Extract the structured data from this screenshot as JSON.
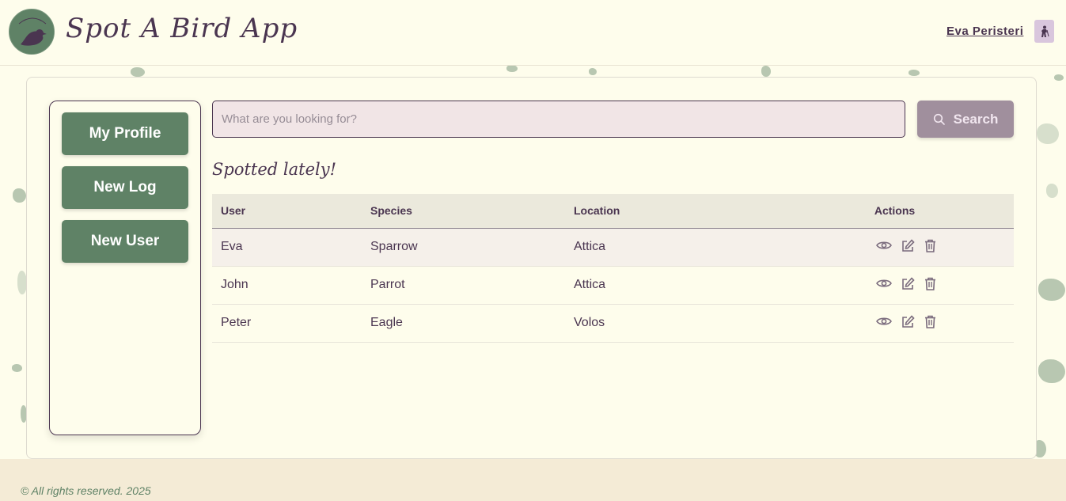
{
  "header": {
    "app_title": "Spot A Bird App",
    "logo_text": "Spot A Bird",
    "user_name": "Eva Peristeri",
    "avatar_icon": "hiker-icon"
  },
  "sidebar": {
    "items": [
      {
        "label": "My Profile"
      },
      {
        "label": "New Log"
      },
      {
        "label": "New User"
      }
    ]
  },
  "search": {
    "placeholder": "What are you looking for?",
    "button_label": "Search",
    "icon": "search-icon"
  },
  "main": {
    "section_title": "Spotted lately!",
    "table": {
      "headers": [
        "User",
        "Species",
        "Location",
        "Actions"
      ],
      "rows": [
        {
          "user": "Eva",
          "species": "Sparrow",
          "location": "Attica"
        },
        {
          "user": "John",
          "species": "Parrot",
          "location": "Attica"
        },
        {
          "user": "Peter",
          "species": "Eagle",
          "location": "Volos"
        }
      ],
      "action_icons": [
        "eye-icon",
        "edit-icon",
        "trash-icon"
      ]
    }
  },
  "footer": {
    "text": "© All rights reserved. 2025"
  },
  "colors": {
    "background": "#fefdec",
    "primary_green": "#5f8266",
    "text_purple": "#4a3550",
    "search_button": "#a08f9d",
    "search_input_bg": "#f1e5e6"
  }
}
